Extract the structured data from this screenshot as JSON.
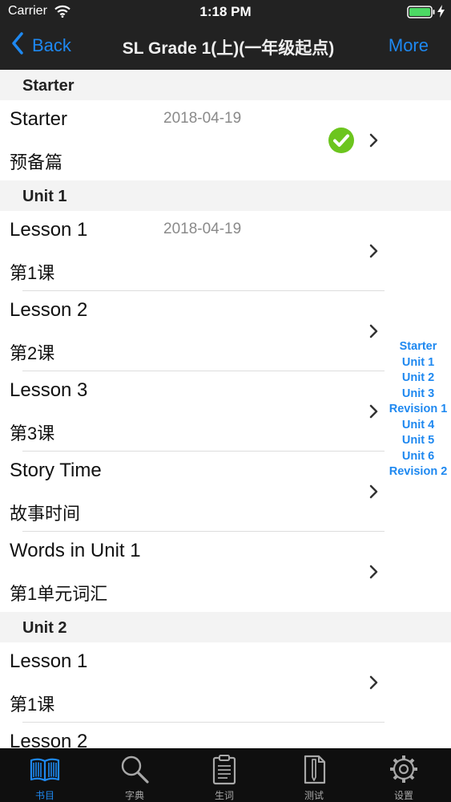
{
  "status_bar": {
    "carrier": "Carrier",
    "time": "1:18 PM"
  },
  "nav": {
    "back_label": "Back",
    "title": "SL Grade 1(上)(一年级起点)",
    "more_label": "More"
  },
  "sections": [
    {
      "header": "Starter",
      "rows": [
        {
          "title": "Starter",
          "subtitle": "预备篇",
          "date": "2018-04-19",
          "completed": true
        }
      ]
    },
    {
      "header": "Unit 1",
      "rows": [
        {
          "title": "Lesson 1",
          "subtitle": "第1课",
          "date": "2018-04-19",
          "completed": false
        },
        {
          "title": "Lesson 2",
          "subtitle": "第2课",
          "date": "",
          "completed": false
        },
        {
          "title": "Lesson 3",
          "subtitle": "第3课",
          "date": "",
          "completed": false
        },
        {
          "title": "Story Time",
          "subtitle": "故事时间",
          "date": "",
          "completed": false
        },
        {
          "title": "Words in Unit 1",
          "subtitle": "第1单元词汇",
          "date": "",
          "completed": false
        }
      ]
    },
    {
      "header": "Unit 2",
      "rows": [
        {
          "title": "Lesson 1",
          "subtitle": "第1课",
          "date": "",
          "completed": false
        },
        {
          "title": "Lesson 2",
          "subtitle": "",
          "date": "",
          "completed": false
        }
      ]
    }
  ],
  "section_index": [
    "Starter",
    "Unit 1",
    "Unit 2",
    "Unit 3",
    "Revision 1",
    "Unit 4",
    "Unit 5",
    "Unit 6",
    "Revision 2"
  ],
  "tabs": [
    {
      "label": "书目",
      "icon": "book-icon",
      "active": true
    },
    {
      "label": "字典",
      "icon": "magnifier-icon",
      "active": false
    },
    {
      "label": "生词",
      "icon": "clipboard-icon",
      "active": false
    },
    {
      "label": "测试",
      "icon": "test-paper-icon",
      "active": false
    },
    {
      "label": "设置",
      "icon": "gear-icon",
      "active": false
    }
  ],
  "colors": {
    "accent": "#1e88f0",
    "bar_background": "#222222",
    "tab_background": "#0f0f0f",
    "check_green": "#6cc51e"
  }
}
